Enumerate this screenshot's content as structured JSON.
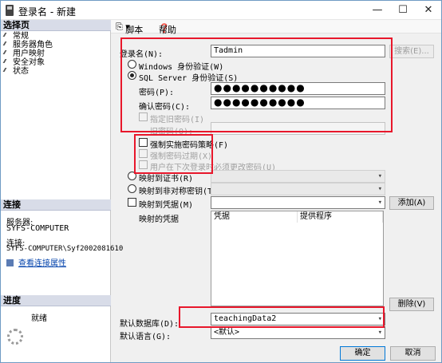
{
  "window": {
    "title": "登录名 - 新建",
    "minimize": "—",
    "maximize": "☐",
    "close": "✕"
  },
  "sidebar": {
    "select_page_header": "选择页",
    "items": [
      {
        "label": "常规"
      },
      {
        "label": "服务器角色"
      },
      {
        "label": "用户映射"
      },
      {
        "label": "安全对象"
      },
      {
        "label": "状态"
      }
    ],
    "connection_header": "连接",
    "server_label": "服务器:",
    "server_value": "SYFS-COMPUTER",
    "connection_label": "连接:",
    "connection_value": "SYFS-COMPUTER\\Syf2002081610",
    "view_properties_link": "查看连接属性",
    "progress_header": "进度",
    "progress_status": "就绪"
  },
  "toolbar": {
    "script_label": "脚本",
    "help_label": "帮助"
  },
  "form": {
    "login_name_label": "登录名(N):",
    "login_name_value": "Tadmin",
    "search_button": "搜索(E)...",
    "windows_auth_label": "Windows 身份验证(W)",
    "sql_auth_label": "SQL Server 身份验证(S)",
    "password_label": "密码(P):",
    "password_value": "●●●●●●●●●●",
    "confirm_password_label": "确认密码(C):",
    "confirm_password_value": "●●●●●●●●●●",
    "specify_old_password_label": "指定旧密码(I)",
    "old_password_label": "旧密码(O):",
    "enforce_policy_label": "强制实施密码策略(F)",
    "enforce_expiration_label": "强制密码过期(X)",
    "must_change_label": "用户在下次登录时必须更改密码(U)",
    "map_certificate_label": "映射到证书(R)",
    "map_asym_key_label": "映射到非对称密钥(T)",
    "map_credential_label": "映射到凭据(M)",
    "add_button": "添加(A)",
    "mapped_credentials_label": "映射的凭据",
    "grid_col_credential": "凭据",
    "grid_col_provider": "提供程序",
    "remove_button": "删除(V)",
    "default_db_label": "默认数据库(D):",
    "default_db_value": "teachingData2",
    "default_lang_label": "默认语言(G):",
    "default_lang_value": "<默认>"
  },
  "footer": {
    "ok_button": "确定",
    "cancel_button": "取消"
  },
  "colors": {
    "annotation_red": "#e8172b",
    "accent_blue": "#0078d7"
  }
}
